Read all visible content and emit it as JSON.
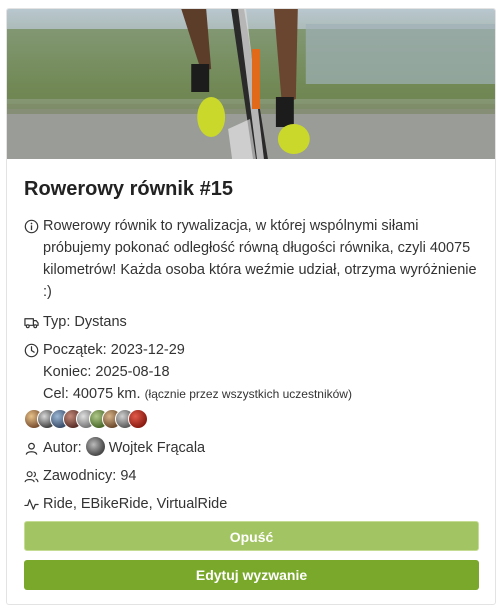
{
  "challenge": {
    "title": "Rowerowy równik #15",
    "description": "Rowerowy równik to rywalizacja, w której wspólnymi siłami próbujemy pokonać odległość równą długości równika, czyli 40075 kilometrów! Każda osoba która weźmie udział, otrzyma wyróżnienie :)",
    "type_label": "Typ: Dystans",
    "start_label": "Początek: 2023-12-29",
    "end_label": "Koniec: 2025-08-18",
    "goal_label": "Cel: 40075 km.",
    "goal_note": "(łącznie przez wszystkich uczestników)",
    "author_prefix": "Autor:",
    "author_name": "Wojtek Frącala",
    "participants_label": "Zawodnicy: 94",
    "activities_label": "Ride, EBikeRide, VirtualRide"
  },
  "actions": {
    "leave_label": "Opuść",
    "edit_label": "Edytuj wyzwanie"
  },
  "colors": {
    "leave_button": "#a3c463",
    "edit_button": "#7aa82b"
  },
  "icons": {
    "description": "info-icon",
    "type": "truck-icon",
    "dates": "clock-icon",
    "author": "user-icon",
    "participants": "users-icon",
    "activities": "activity-icon"
  }
}
